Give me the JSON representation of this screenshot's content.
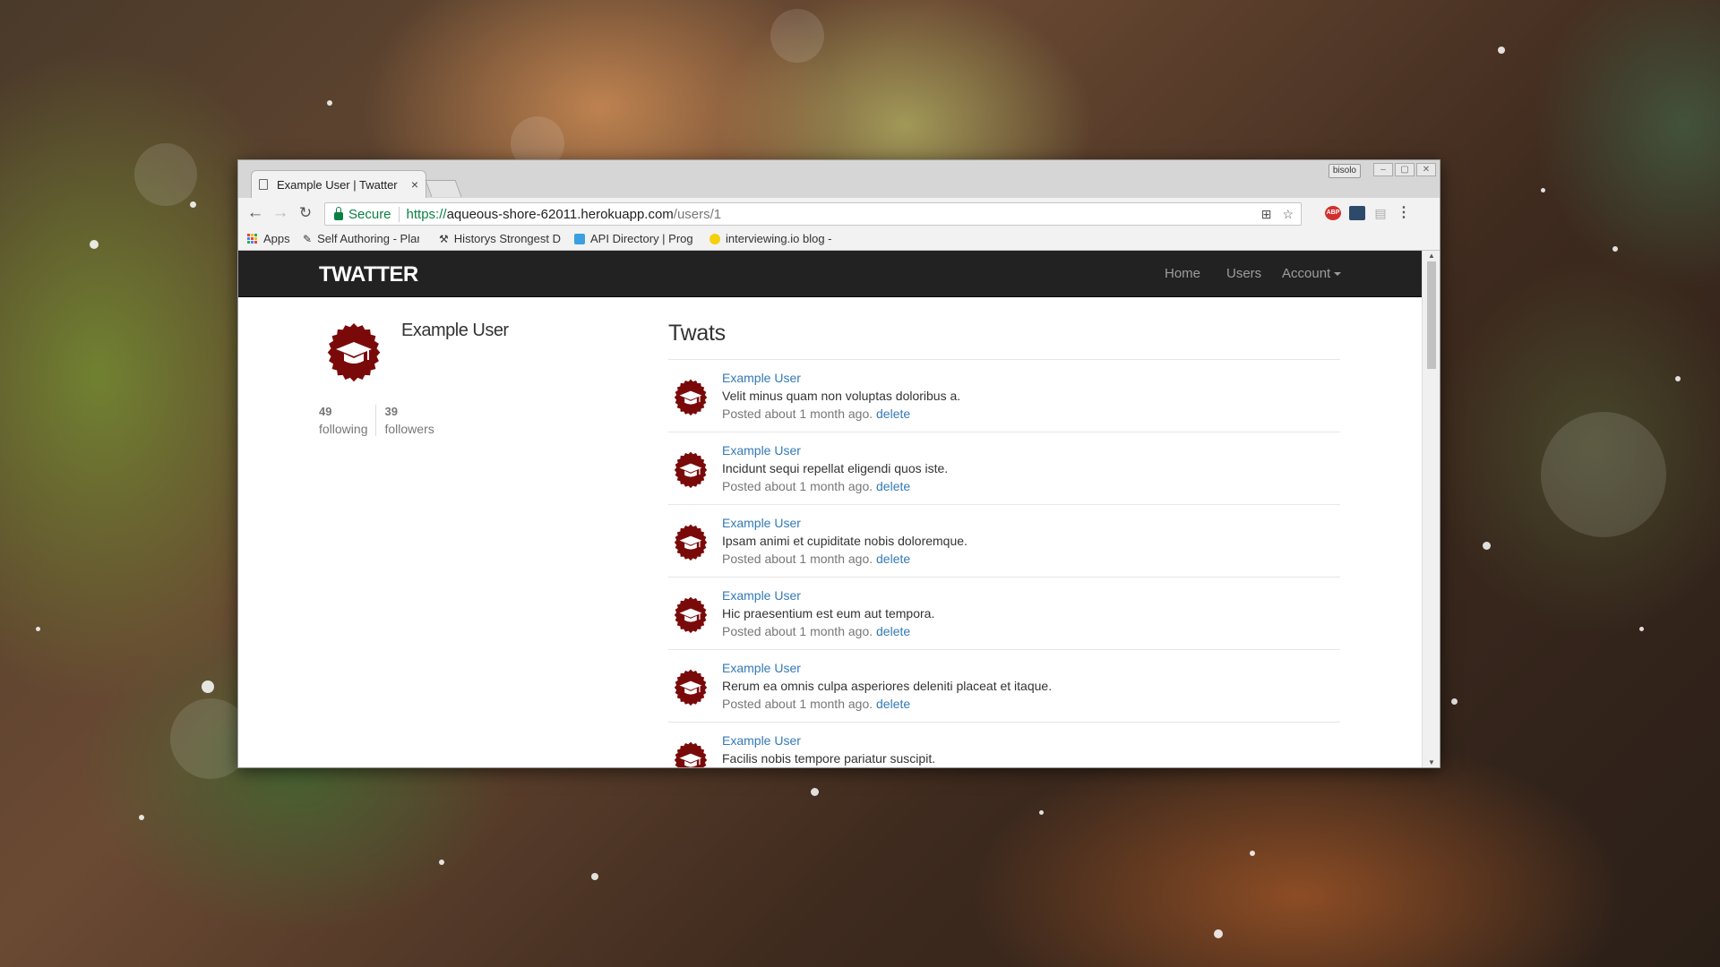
{
  "browser": {
    "tab_title": "Example User | Twatter",
    "tab_close": "×",
    "window_badge": "bisolo",
    "secure_label": "Secure",
    "url": {
      "scheme": "https://",
      "host": "aqueous-shore-62011.herokuapp.com",
      "path": "/users/1"
    },
    "bookmarks": [
      {
        "label": "Apps",
        "icon": "apps-grid-icon"
      },
      {
        "label": "Self Authoring - Plan",
        "icon": "pen-icon"
      },
      {
        "label": "Historys Strongest D",
        "icon": "hammer-icon"
      },
      {
        "label": "API Directory | Prog",
        "icon": "puzzle-icon"
      },
      {
        "label": "interviewing.io blog -",
        "icon": "eye-icon"
      }
    ]
  },
  "navbar": {
    "brand": "TWATTER",
    "links": {
      "home": "Home",
      "users": "Users",
      "account": "Account"
    }
  },
  "profile": {
    "name": "Example User",
    "following_count": "49",
    "following_label": "following",
    "followers_count": "39",
    "followers_label": "followers"
  },
  "twats": {
    "heading": "Twats",
    "items": [
      {
        "user": "Example User",
        "content": "Velit minus quam non voluptas doloribus a.",
        "meta": "Posted about 1 month ago.",
        "delete": "delete"
      },
      {
        "user": "Example User",
        "content": "Incidunt sequi repellat eligendi quos iste.",
        "meta": "Posted about 1 month ago.",
        "delete": "delete"
      },
      {
        "user": "Example User",
        "content": "Ipsam animi et cupiditate nobis doloremque.",
        "meta": "Posted about 1 month ago.",
        "delete": "delete"
      },
      {
        "user": "Example User",
        "content": "Hic praesentium est eum aut tempora.",
        "meta": "Posted about 1 month ago.",
        "delete": "delete"
      },
      {
        "user": "Example User",
        "content": "Rerum ea omnis culpa asperiores deleniti placeat et itaque.",
        "meta": "Posted about 1 month ago.",
        "delete": "delete"
      },
      {
        "user": "Example User",
        "content": "Facilis nobis tempore pariatur suscipit.",
        "meta": "",
        "delete": ""
      }
    ]
  },
  "colors": {
    "navbar_bg": "#222222",
    "link": "#337ab7",
    "seal": "#7a0a0a",
    "secure_green": "#0b8043"
  }
}
